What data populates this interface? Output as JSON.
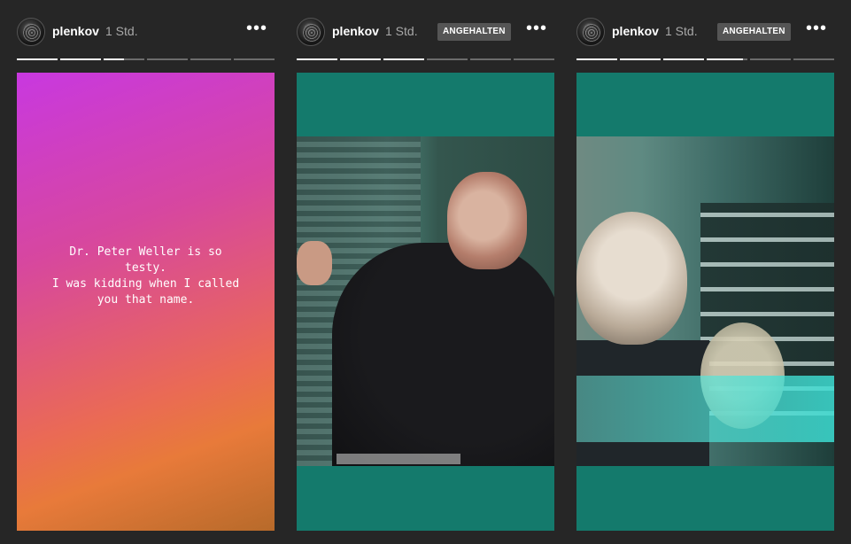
{
  "stories": [
    {
      "username": "plenkov",
      "time": "1 Std.",
      "caption_lines": [
        "Dr. Peter Weller is so",
        "testy.",
        "I was kidding when I called",
        "you that name."
      ],
      "progress": [
        1,
        1,
        0.5,
        0,
        0,
        0
      ],
      "type": "text"
    },
    {
      "username": "plenkov",
      "time": "1 Std.",
      "badge": "ANGEHALTEN",
      "progress": [
        1,
        1,
        1,
        0,
        0,
        0
      ],
      "type": "video"
    },
    {
      "username": "plenkov",
      "time": "1 Std.",
      "badge": "ANGEHALTEN",
      "progress": [
        1,
        1,
        1,
        0.9,
        0,
        0
      ],
      "type": "video"
    }
  ],
  "more_icon": "more-horizontal-icon",
  "colors": {
    "background": "#262626",
    "badge": "#555555",
    "video_frame": "#147a6c",
    "progress_track": "#6c6c6c",
    "progress_fill": "#ffffff"
  }
}
